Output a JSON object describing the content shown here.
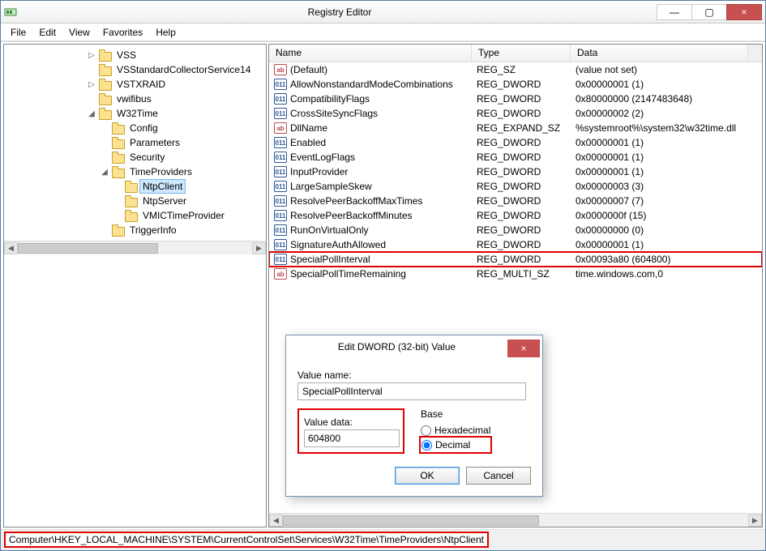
{
  "window": {
    "title": "Registry Editor"
  },
  "winbtns": {
    "min": "—",
    "max": "▢",
    "close": "×"
  },
  "menu": {
    "file": "File",
    "edit": "Edit",
    "view": "View",
    "favorites": "Favorites",
    "help": "Help"
  },
  "tree": {
    "nodes": [
      {
        "d": 6,
        "exp": "▷",
        "label": "VSS"
      },
      {
        "d": 6,
        "exp": "",
        "label": "VSStandardCollectorService14"
      },
      {
        "d": 6,
        "exp": "▷",
        "label": "VSTXRAID"
      },
      {
        "d": 6,
        "exp": "",
        "label": "vwifibus"
      },
      {
        "d": 6,
        "exp": "◢",
        "label": "W32Time"
      },
      {
        "d": 7,
        "exp": "",
        "label": "Config"
      },
      {
        "d": 7,
        "exp": "",
        "label": "Parameters"
      },
      {
        "d": 7,
        "exp": "",
        "label": "Security"
      },
      {
        "d": 7,
        "exp": "◢",
        "label": "TimeProviders"
      },
      {
        "d": 8,
        "exp": "",
        "label": "NtpClient",
        "selected": true
      },
      {
        "d": 8,
        "exp": "",
        "label": "NtpServer"
      },
      {
        "d": 8,
        "exp": "",
        "label": "VMICTimeProvider"
      },
      {
        "d": 7,
        "exp": "",
        "label": "TriggerInfo"
      }
    ]
  },
  "list": {
    "headers": {
      "name": "Name",
      "type": "Type",
      "data": "Data"
    },
    "rows": [
      {
        "icon": "str",
        "name": "(Default)",
        "type": "REG_SZ",
        "data": "(value not set)"
      },
      {
        "icon": "bin",
        "name": "AllowNonstandardModeCombinations",
        "type": "REG_DWORD",
        "data": "0x00000001 (1)"
      },
      {
        "icon": "bin",
        "name": "CompatibilityFlags",
        "type": "REG_DWORD",
        "data": "0x80000000 (2147483648)"
      },
      {
        "icon": "bin",
        "name": "CrossSiteSyncFlags",
        "type": "REG_DWORD",
        "data": "0x00000002 (2)"
      },
      {
        "icon": "str",
        "name": "DllName",
        "type": "REG_EXPAND_SZ",
        "data": "%systemroot%\\system32\\w32time.dll"
      },
      {
        "icon": "bin",
        "name": "Enabled",
        "type": "REG_DWORD",
        "data": "0x00000001 (1)"
      },
      {
        "icon": "bin",
        "name": "EventLogFlags",
        "type": "REG_DWORD",
        "data": "0x00000001 (1)"
      },
      {
        "icon": "bin",
        "name": "InputProvider",
        "type": "REG_DWORD",
        "data": "0x00000001 (1)"
      },
      {
        "icon": "bin",
        "name": "LargeSampleSkew",
        "type": "REG_DWORD",
        "data": "0x00000003 (3)"
      },
      {
        "icon": "bin",
        "name": "ResolvePeerBackoffMaxTimes",
        "type": "REG_DWORD",
        "data": "0x00000007 (7)"
      },
      {
        "icon": "bin",
        "name": "ResolvePeerBackoffMinutes",
        "type": "REG_DWORD",
        "data": "0x0000000f (15)"
      },
      {
        "icon": "bin",
        "name": "RunOnVirtualOnly",
        "type": "REG_DWORD",
        "data": "0x00000000 (0)"
      },
      {
        "icon": "bin",
        "name": "SignatureAuthAllowed",
        "type": "REG_DWORD",
        "data": "0x00000001 (1)"
      },
      {
        "icon": "bin",
        "name": "SpecialPollInterval",
        "type": "REG_DWORD",
        "data": "0x00093a80 (604800)",
        "hl": true
      },
      {
        "icon": "str",
        "name": "SpecialPollTimeRemaining",
        "type": "REG_MULTI_SZ",
        "data": "time.windows.com,0"
      }
    ]
  },
  "dialog": {
    "title": "Edit DWORD (32-bit) Value",
    "close": "×",
    "value_name_lbl": "Value name:",
    "value_name": "SpecialPollInterval",
    "value_data_lbl": "Value data:",
    "value_data": "604800",
    "base_lbl": "Base",
    "hex": "Hexadecimal",
    "dec": "Decimal",
    "ok": "OK",
    "cancel": "Cancel"
  },
  "status": {
    "path": "Computer\\HKEY_LOCAL_MACHINE\\SYSTEM\\CurrentControlSet\\Services\\W32Time\\TimeProviders\\NtpClient"
  },
  "icons": {
    "str_txt": "ab",
    "bin_txt": "011"
  }
}
